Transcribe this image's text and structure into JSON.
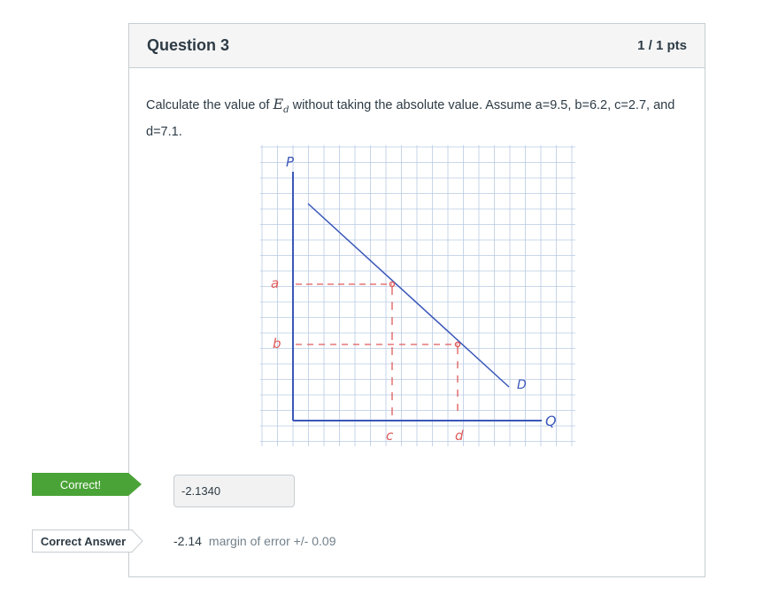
{
  "question": {
    "title": "Question 3",
    "points": "1 / 1 pts",
    "text_before": "Calculate the value of ",
    "var_main": "E",
    "var_sub": "d",
    "text_after": " without taking the absolute value.  Assume a=9.5, b=6.2, c=2.7, and d=7.1."
  },
  "graph": {
    "labels": {
      "p_axis": "P",
      "q_axis": "Q",
      "a": "a",
      "b": "b",
      "c": "c",
      "d": "d",
      "demand": "D"
    },
    "colors": {
      "grid": "#b9cbe4",
      "axis": "#3a57b8",
      "demand": "#3a57b8",
      "dashed": "#e05a5a",
      "axis_label": "#3a57b8",
      "point_label": "#e05a5a"
    }
  },
  "response": {
    "status_flag": "Correct!",
    "user_answer": "-2.1340",
    "correct_flag": "Correct Answer",
    "correct_value": "-2.14",
    "margin_text": "margin of error +/- 0.09"
  },
  "colors": {
    "correct_green": "#4aa336",
    "border": "#c7cdd1",
    "header_bg": "#f5f5f5",
    "text": "#2d3b45",
    "muted": "#73818c"
  }
}
